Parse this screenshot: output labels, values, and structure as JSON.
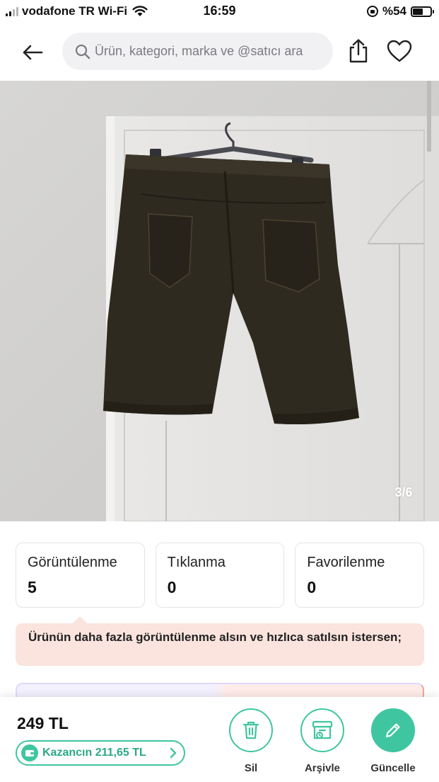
{
  "status_bar": {
    "carrier": "vodafone TR Wi-Fi",
    "time": "16:59",
    "battery": "%54",
    "battery_level": 0.54
  },
  "header": {
    "search_placeholder": "Ürün, kategori, marka ve @satıcı ara",
    "icons": [
      "back-arrow-icon",
      "search-icon",
      "share-icon",
      "heart-icon"
    ]
  },
  "product_image": {
    "counter": "3/6"
  },
  "stats": [
    {
      "label": "Görüntülenme",
      "value": "5"
    },
    {
      "label": "Tıklanma",
      "value": "0"
    },
    {
      "label": "Favorilenme",
      "value": "0"
    }
  ],
  "tip": {
    "text": "Ürünün daha fazla görüntülenme alsın ve hızlıca satılsın istersen;"
  },
  "bottom_bar": {
    "price": "249 TL",
    "earnings": "Kazancın 211,65 TL",
    "actions": [
      {
        "label": "Sil",
        "icon": "trash-icon"
      },
      {
        "label": "Arşivle",
        "icon": "archive-icon"
      },
      {
        "label": "Güncelle",
        "icon": "pencil-icon"
      }
    ]
  },
  "colors": {
    "accent": "#3fc6a0",
    "tip_background": "#fbe4de",
    "search_background": "#f1f1f3"
  }
}
